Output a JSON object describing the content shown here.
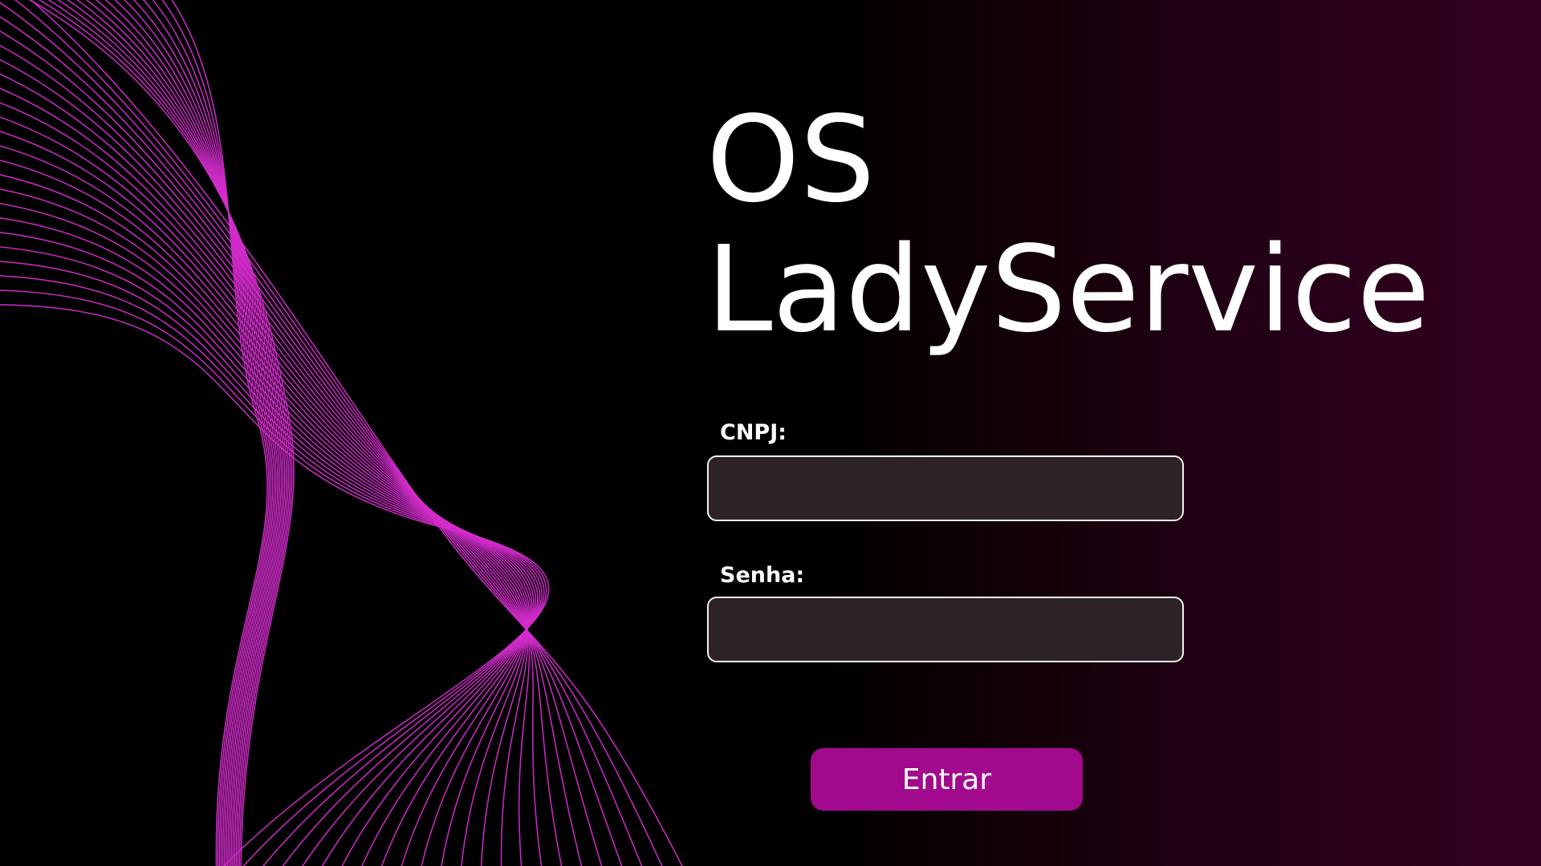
{
  "title": {
    "line1": "OS",
    "line2": "LadyService"
  },
  "form": {
    "cnpj": {
      "label": "CNPJ:",
      "value": "",
      "placeholder": ""
    },
    "senha": {
      "label": "Senha:",
      "value": "",
      "placeholder": ""
    },
    "submit_label": "Entrar"
  },
  "colors": {
    "accent": "#a20a8d",
    "wave": "#d42ccc",
    "input_bg": "#2e2229",
    "background_end": "#340020"
  },
  "decoration": {
    "icon": "pink-wave-lines"
  }
}
